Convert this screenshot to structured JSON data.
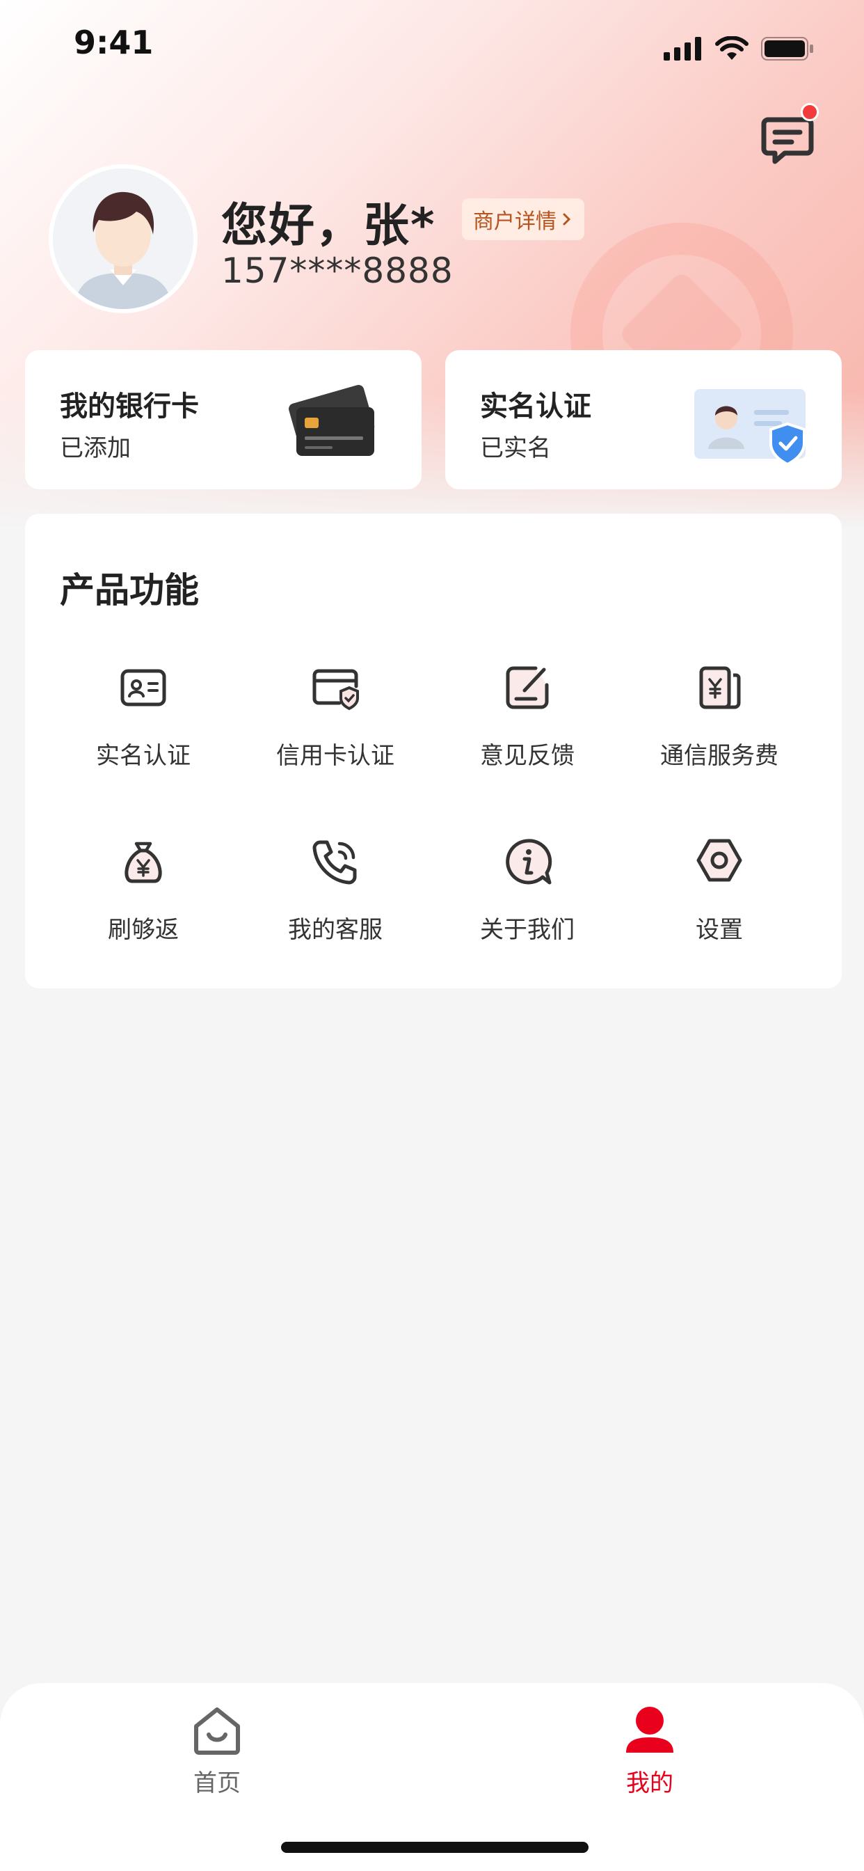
{
  "status_bar": {
    "time": "9:41"
  },
  "header": {
    "greeting": "您好，张*",
    "merchant_label": "商户详情",
    "phone": "157****8888"
  },
  "cards": [
    {
      "title": "我的银行卡",
      "subtitle": "已添加",
      "icon": "bank-card-icon"
    },
    {
      "title": "实名认证",
      "subtitle": "已实名",
      "icon": "id-verified-icon"
    }
  ],
  "features": {
    "title": "产品功能",
    "items": [
      {
        "label": "实名认证",
        "icon": "id-card-icon"
      },
      {
        "label": "信用卡认证",
        "icon": "credit-card-shield-icon"
      },
      {
        "label": "意见反馈",
        "icon": "edit-note-icon"
      },
      {
        "label": "通信服务费",
        "icon": "yuan-document-icon"
      },
      {
        "label": "刷够返",
        "icon": "money-bag-icon"
      },
      {
        "label": "我的客服",
        "icon": "phone-call-icon"
      },
      {
        "label": "关于我们",
        "icon": "info-bubble-icon"
      },
      {
        "label": "设置",
        "icon": "hex-settings-icon"
      }
    ]
  },
  "tabbar": {
    "items": [
      {
        "label": "首页",
        "icon": "home-icon",
        "active": false
      },
      {
        "label": "我的",
        "icon": "user-icon",
        "active": true
      }
    ]
  },
  "colors": {
    "accent": "#e8001c",
    "primary_text": "#222222",
    "inactive_tab": "#666666",
    "badge": "#f23b3b"
  }
}
